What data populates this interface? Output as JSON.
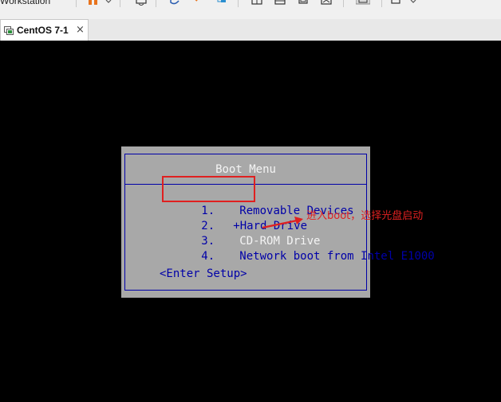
{
  "toolbar": {
    "app_label": "Workstation"
  },
  "tab": {
    "title": "CentOS 7-1",
    "close_label": "×"
  },
  "boot_menu": {
    "title": "Boot Menu",
    "items": [
      {
        "num": "1.",
        "label": "Removable Devices"
      },
      {
        "num": "2.",
        "label": "+Hard Drive"
      },
      {
        "num": "3.",
        "label": "CD-ROM Drive"
      },
      {
        "num": "4.",
        "label": "Network boot from Intel E1000"
      }
    ],
    "setup_label": "<Enter Setup>"
  },
  "annotation": {
    "text": "进入boot，选择光盘启动"
  },
  "colors": {
    "screen_bg": "#000000",
    "menu_bg": "#a8a8a8",
    "menu_text": "#0000a8",
    "menu_title": "#f4f4f4",
    "annotation": "#e02020",
    "toolbar_accent": "#e8731c"
  },
  "icons": [
    "pause-icon",
    "send-keys-icon",
    "snapshot-icon",
    "revert-icon",
    "manage-snapshots-icon",
    "view-icon",
    "tab-vm-icon"
  ]
}
